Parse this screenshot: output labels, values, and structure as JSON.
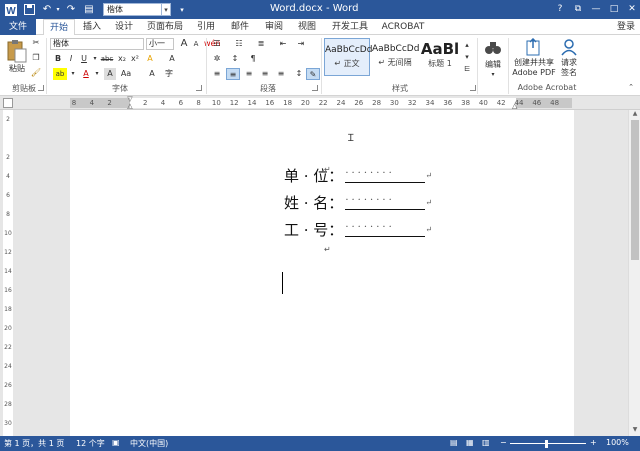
{
  "titlebar": {
    "doc_title": "Word.docx - Word",
    "font_quick_value": "楷体",
    "help": "?",
    "restore": "⧉",
    "minimize": "—",
    "maximize": "□",
    "close": "✕",
    "sign_in": "登录"
  },
  "tabs": {
    "file": "文件",
    "home": "开始",
    "insert": "插入",
    "design": "设计",
    "layout": "页面布局",
    "references": "引用",
    "mailings": "邮件",
    "review": "审阅",
    "view": "视图",
    "developer": "开发工具",
    "acrobat": "ACROBAT"
  },
  "ribbon": {
    "clipboard": {
      "paste": "粘贴",
      "group": "剪贴板"
    },
    "font": {
      "font_name": "楷体",
      "font_size": "小一",
      "grow": "A",
      "shrink": "A",
      "case": "Aa",
      "clear": "A",
      "wen": "wén",
      "border_char": "A",
      "bold": "B",
      "italic": "I",
      "underline": "U",
      "strike": "abc",
      "sub": "x₂",
      "super": "x²",
      "effects": "A",
      "highlight": "ab",
      "color": "A",
      "shade": "A",
      "aa2": "Aa",
      "circle": "字",
      "group": "字体"
    },
    "paragraph": {
      "group": "段落"
    },
    "styles": {
      "items": [
        {
          "sample": "AaBbCcDd",
          "name": "↵ 正文"
        },
        {
          "sample": "AaBbCcDd",
          "name": "↵ 无间隔"
        },
        {
          "sample": "AaBl",
          "name": "标题 1"
        }
      ],
      "group": "样式"
    },
    "editing": {
      "label": "编辑"
    },
    "acrobat": {
      "create_share_line1": "创建并共享",
      "create_share_line2": "Adobe PDF",
      "request_line1": "请求",
      "request_line2": "签名",
      "group": "Adobe Acrobat"
    }
  },
  "ruler": {
    "numbers": [
      "8",
      "4",
      "2",
      "",
      "2",
      "4",
      "6",
      "8",
      "10",
      "12",
      "14",
      "16",
      "18",
      "20",
      "22",
      "24",
      "26",
      "28",
      "30",
      "32",
      "34",
      "36",
      "38",
      "40",
      "42",
      "44",
      "46",
      "48"
    ]
  },
  "vruler": {
    "numbers": [
      "2",
      "",
      "2",
      "4",
      "6",
      "8",
      "10",
      "12",
      "14",
      "16",
      "18",
      "20",
      "22",
      "24",
      "26",
      "28",
      "30"
    ]
  },
  "document": {
    "para_marks": [
      "↵",
      "↵"
    ],
    "fields": [
      {
        "label": "单 · 位：",
        "dots": "········",
        "mark": "↵"
      },
      {
        "label": "姓 · 名：",
        "dots": "········",
        "mark": "↵"
      },
      {
        "label": "工 · 号：",
        "dots": "········",
        "mark": "↵"
      }
    ]
  },
  "statusbar": {
    "page": "第 1 页，共 1 页",
    "words": "12 个字",
    "language": "中文(中国)",
    "zoom_minus": "−",
    "zoom_plus": "+",
    "zoom": "100%"
  },
  "colors": {
    "accent": "#2b579a"
  }
}
